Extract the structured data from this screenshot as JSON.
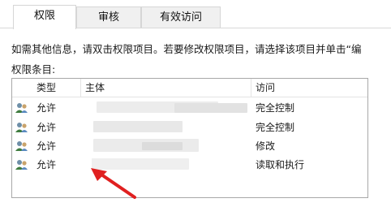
{
  "tabs": [
    {
      "label": "权限",
      "active": true
    },
    {
      "label": "审核",
      "active": false
    },
    {
      "label": "有效访问",
      "active": false
    }
  ],
  "info_text": "如需其他信息，请双击权限项目。若要修改权限项目，请选择该项目并单击“编",
  "entries_label": "权限条目:",
  "columns": {
    "type": "类型",
    "principal": "主体",
    "access": "访问"
  },
  "rows": [
    {
      "type": "允许",
      "access": "完全控制",
      "icon": "users-icon"
    },
    {
      "type": "允许",
      "access": "完全控制",
      "icon": "users-icon"
    },
    {
      "type": "允许",
      "access": "修改",
      "icon": "users-icon"
    },
    {
      "type": "允许",
      "access": "读取和执行",
      "icon": "users-icon"
    }
  ],
  "colors": {
    "arrow": "#e02020",
    "tab_bg": "#f0f0f0",
    "border": "#a8a8a8"
  }
}
